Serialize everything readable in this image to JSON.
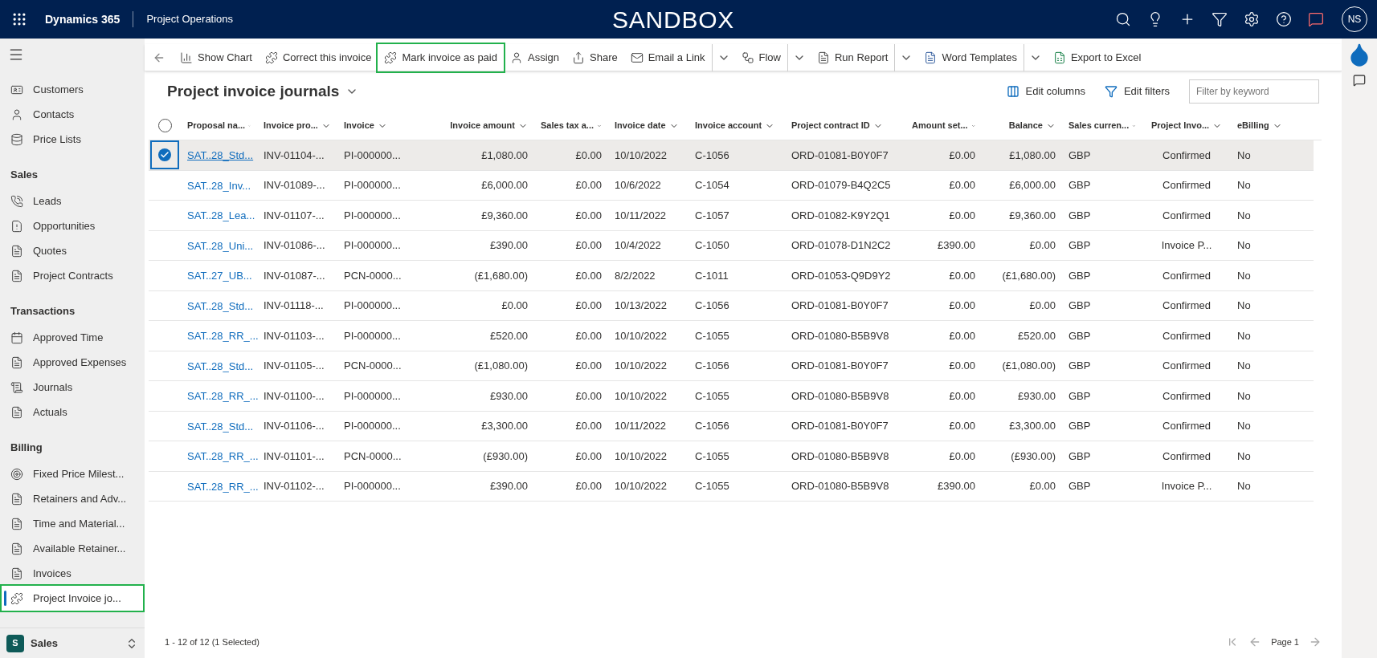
{
  "topbar": {
    "app": "Dynamics 365",
    "area": "Project Operations",
    "banner": "SANDBOX",
    "user": "NS"
  },
  "commands": [
    {
      "label": "Show Chart",
      "highlighted": false,
      "caret": false
    },
    {
      "label": "Correct this invoice",
      "highlighted": false,
      "caret": false
    },
    {
      "label": "Mark invoice as paid",
      "highlighted": true,
      "caret": false
    },
    {
      "label": "Assign",
      "highlighted": false,
      "caret": false
    },
    {
      "label": "Share",
      "highlighted": false,
      "caret": false
    },
    {
      "label": "Email a Link",
      "highlighted": false,
      "caret": true
    },
    {
      "label": "Flow",
      "highlighted": false,
      "caret": true
    },
    {
      "label": "Run Report",
      "highlighted": false,
      "caret": true
    },
    {
      "label": "Word Templates",
      "highlighted": false,
      "caret": true
    },
    {
      "label": "Export to Excel",
      "highlighted": false,
      "caret": false
    }
  ],
  "sidebar": {
    "groups": [
      {
        "items": [
          {
            "label": "Customers",
            "selected": false,
            "highlighted": false
          },
          {
            "label": "Contacts",
            "selected": false,
            "highlighted": false
          },
          {
            "label": "Price Lists",
            "selected": false,
            "highlighted": false
          }
        ]
      },
      {
        "title": "Sales",
        "items": [
          {
            "label": "Leads",
            "selected": false,
            "highlighted": false
          },
          {
            "label": "Opportunities",
            "selected": false,
            "highlighted": false
          },
          {
            "label": "Quotes",
            "selected": false,
            "highlighted": false
          },
          {
            "label": "Project Contracts",
            "selected": false,
            "highlighted": false
          }
        ]
      },
      {
        "title": "Transactions",
        "items": [
          {
            "label": "Approved Time",
            "selected": false,
            "highlighted": false
          },
          {
            "label": "Approved Expenses",
            "selected": false,
            "highlighted": false
          },
          {
            "label": "Journals",
            "selected": false,
            "highlighted": false
          },
          {
            "label": "Actuals",
            "selected": false,
            "highlighted": false
          }
        ]
      },
      {
        "title": "Billing",
        "items": [
          {
            "label": "Fixed Price Milest...",
            "selected": false,
            "highlighted": false
          },
          {
            "label": "Retainers and Adv...",
            "selected": false,
            "highlighted": false
          },
          {
            "label": "Time and Material...",
            "selected": false,
            "highlighted": false
          },
          {
            "label": "Available Retainer...",
            "selected": false,
            "highlighted": false
          },
          {
            "label": "Invoices",
            "selected": false,
            "highlighted": false
          },
          {
            "label": "Project Invoice jo...",
            "selected": true,
            "highlighted": true
          }
        ]
      }
    ],
    "area": {
      "badge": "S",
      "label": "Sales"
    }
  },
  "view": {
    "title": "Project invoice journals",
    "edit_columns": "Edit columns",
    "edit_filters": "Edit filters",
    "filter_placeholder": "Filter by keyword"
  },
  "table": {
    "select_all": {
      "checked": false
    },
    "columns": [
      "Proposal na...",
      "Invoice pro...",
      "Invoice",
      "Invoice amount",
      "Sales tax a...",
      "Invoice date",
      "Invoice account",
      "Project contract ID",
      "Amount set...",
      "Balance",
      "Sales curren...",
      "Project Invo...",
      "eBilling"
    ],
    "rows": [
      {
        "selected": true,
        "cells": [
          "SAT..28_Std...",
          "INV-01104-...",
          "PI-000000...",
          "£1,080.00",
          "£0.00",
          "10/10/2022",
          "C-1056",
          "ORD-01081-B0Y0F7",
          "£0.00",
          "£1,080.00",
          "GBP",
          "Confirmed",
          "No"
        ]
      },
      {
        "selected": false,
        "cells": [
          "SAT..28_Inv...",
          "INV-01089-...",
          "PI-000000...",
          "£6,000.00",
          "£0.00",
          "10/6/2022",
          "C-1054",
          "ORD-01079-B4Q2C5",
          "£0.00",
          "£6,000.00",
          "GBP",
          "Confirmed",
          "No"
        ]
      },
      {
        "selected": false,
        "cells": [
          "SAT..28_Lea...",
          "INV-01107-...",
          "PI-000000...",
          "£9,360.00",
          "£0.00",
          "10/11/2022",
          "C-1057",
          "ORD-01082-K9Y2Q1",
          "£0.00",
          "£9,360.00",
          "GBP",
          "Confirmed",
          "No"
        ]
      },
      {
        "selected": false,
        "cells": [
          "SAT..28_Uni...",
          "INV-01086-...",
          "PI-000000...",
          "£390.00",
          "£0.00",
          "10/4/2022",
          "C-1050",
          "ORD-01078-D1N2C2",
          "£390.00",
          "£0.00",
          "GBP",
          "Invoice P...",
          "No"
        ]
      },
      {
        "selected": false,
        "cells": [
          "SAT..27_UB...",
          "INV-01087-...",
          "PCN-0000...",
          "(£1,680.00)",
          "£0.00",
          "8/2/2022",
          "C-1011",
          "ORD-01053-Q9D9Y2",
          "£0.00",
          "(£1,680.00)",
          "GBP",
          "Confirmed",
          "No"
        ]
      },
      {
        "selected": false,
        "cells": [
          "SAT..28_Std...",
          "INV-01118-...",
          "PI-000000...",
          "£0.00",
          "£0.00",
          "10/13/2022",
          "C-1056",
          "ORD-01081-B0Y0F7",
          "£0.00",
          "£0.00",
          "GBP",
          "Confirmed",
          "No"
        ]
      },
      {
        "selected": false,
        "cells": [
          "SAT..28_RR_...",
          "INV-01103-...",
          "PI-000000...",
          "£520.00",
          "£0.00",
          "10/10/2022",
          "C-1055",
          "ORD-01080-B5B9V8",
          "£0.00",
          "£520.00",
          "GBP",
          "Confirmed",
          "No"
        ]
      },
      {
        "selected": false,
        "cells": [
          "SAT..28_Std...",
          "INV-01105-...",
          "PCN-0000...",
          "(£1,080.00)",
          "£0.00",
          "10/10/2022",
          "C-1056",
          "ORD-01081-B0Y0F7",
          "£0.00",
          "(£1,080.00)",
          "GBP",
          "Confirmed",
          "No"
        ]
      },
      {
        "selected": false,
        "cells": [
          "SAT..28_RR_...",
          "INV-01100-...",
          "PI-000000...",
          "£930.00",
          "£0.00",
          "10/10/2022",
          "C-1055",
          "ORD-01080-B5B9V8",
          "£0.00",
          "£930.00",
          "GBP",
          "Confirmed",
          "No"
        ]
      },
      {
        "selected": false,
        "cells": [
          "SAT..28_Std...",
          "INV-01106-...",
          "PI-000000...",
          "£3,300.00",
          "£0.00",
          "10/11/2022",
          "C-1056",
          "ORD-01081-B0Y0F7",
          "£0.00",
          "£3,300.00",
          "GBP",
          "Confirmed",
          "No"
        ]
      },
      {
        "selected": false,
        "cells": [
          "SAT..28_RR_...",
          "INV-01101-...",
          "PCN-0000...",
          "(£930.00)",
          "£0.00",
          "10/10/2022",
          "C-1055",
          "ORD-01080-B5B9V8",
          "£0.00",
          "(£930.00)",
          "GBP",
          "Confirmed",
          "No"
        ]
      },
      {
        "selected": false,
        "cells": [
          "SAT..28_RR_...",
          "INV-01102-...",
          "PI-000000...",
          "£390.00",
          "£0.00",
          "10/10/2022",
          "C-1055",
          "ORD-01080-B5B9V8",
          "£390.00",
          "£0.00",
          "GBP",
          "Invoice P...",
          "No"
        ]
      }
    ]
  },
  "footer": {
    "count": "1 - 12 of 12 (1 Selected)",
    "page": "Page 1"
  }
}
